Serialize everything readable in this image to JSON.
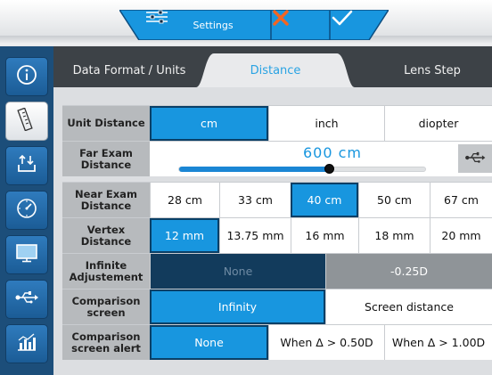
{
  "header": {
    "settings_label": "Settings",
    "icons": [
      "sliders-icon",
      "close-icon",
      "check-icon"
    ],
    "colors": {
      "tab_blue": "#1896df",
      "cancel": "#f26522"
    }
  },
  "sidebar": {
    "items": [
      {
        "icon": "info-icon",
        "active": false
      },
      {
        "icon": "ruler-icon",
        "active": true
      },
      {
        "icon": "download-icon",
        "active": false
      },
      {
        "icon": "dial-icon",
        "active": false
      },
      {
        "icon": "monitor-icon",
        "active": false
      },
      {
        "icon": "usb-icon",
        "active": false
      },
      {
        "icon": "chart-icon",
        "active": false
      }
    ]
  },
  "tabs": [
    {
      "label": "Data Format / Units",
      "active": false
    },
    {
      "label": "Distance",
      "active": true
    },
    {
      "label": "Lens Step",
      "active": false
    }
  ],
  "rows": {
    "unit_distance": {
      "label": "Unit Distance",
      "options": [
        "cm",
        "inch",
        "diopter"
      ],
      "selected": "cm"
    },
    "far_exam": {
      "label_1": "Far Exam",
      "label_2": "Distance",
      "value": "600 cm",
      "slider_fraction": 0.61
    },
    "near_exam": {
      "label_1": "Near Exam",
      "label_2": "Distance",
      "options": [
        "28 cm",
        "33 cm",
        "40 cm",
        "50 cm",
        "67 cm"
      ],
      "selected": "40 cm"
    },
    "vertex": {
      "label": "Vertex Distance",
      "options": [
        "12 mm",
        "13.75 mm",
        "16 mm",
        "18 mm",
        "20 mm"
      ],
      "selected": "12 mm"
    },
    "infinite": {
      "label_1": "Infinite",
      "label_2": "Adjustement",
      "options": [
        "None",
        "-0.25D"
      ]
    },
    "comparison": {
      "label_1": "Comparison",
      "label_2": "screen",
      "options": [
        "Infinity",
        "Screen distance"
      ],
      "selected": "Infinity"
    },
    "comparison_alert": {
      "label_1": "Comparison",
      "label_2": "screen alert",
      "options": [
        "None",
        "When Δ > 0.50D",
        "When Δ > 1.00D"
      ],
      "selected": "None"
    }
  }
}
